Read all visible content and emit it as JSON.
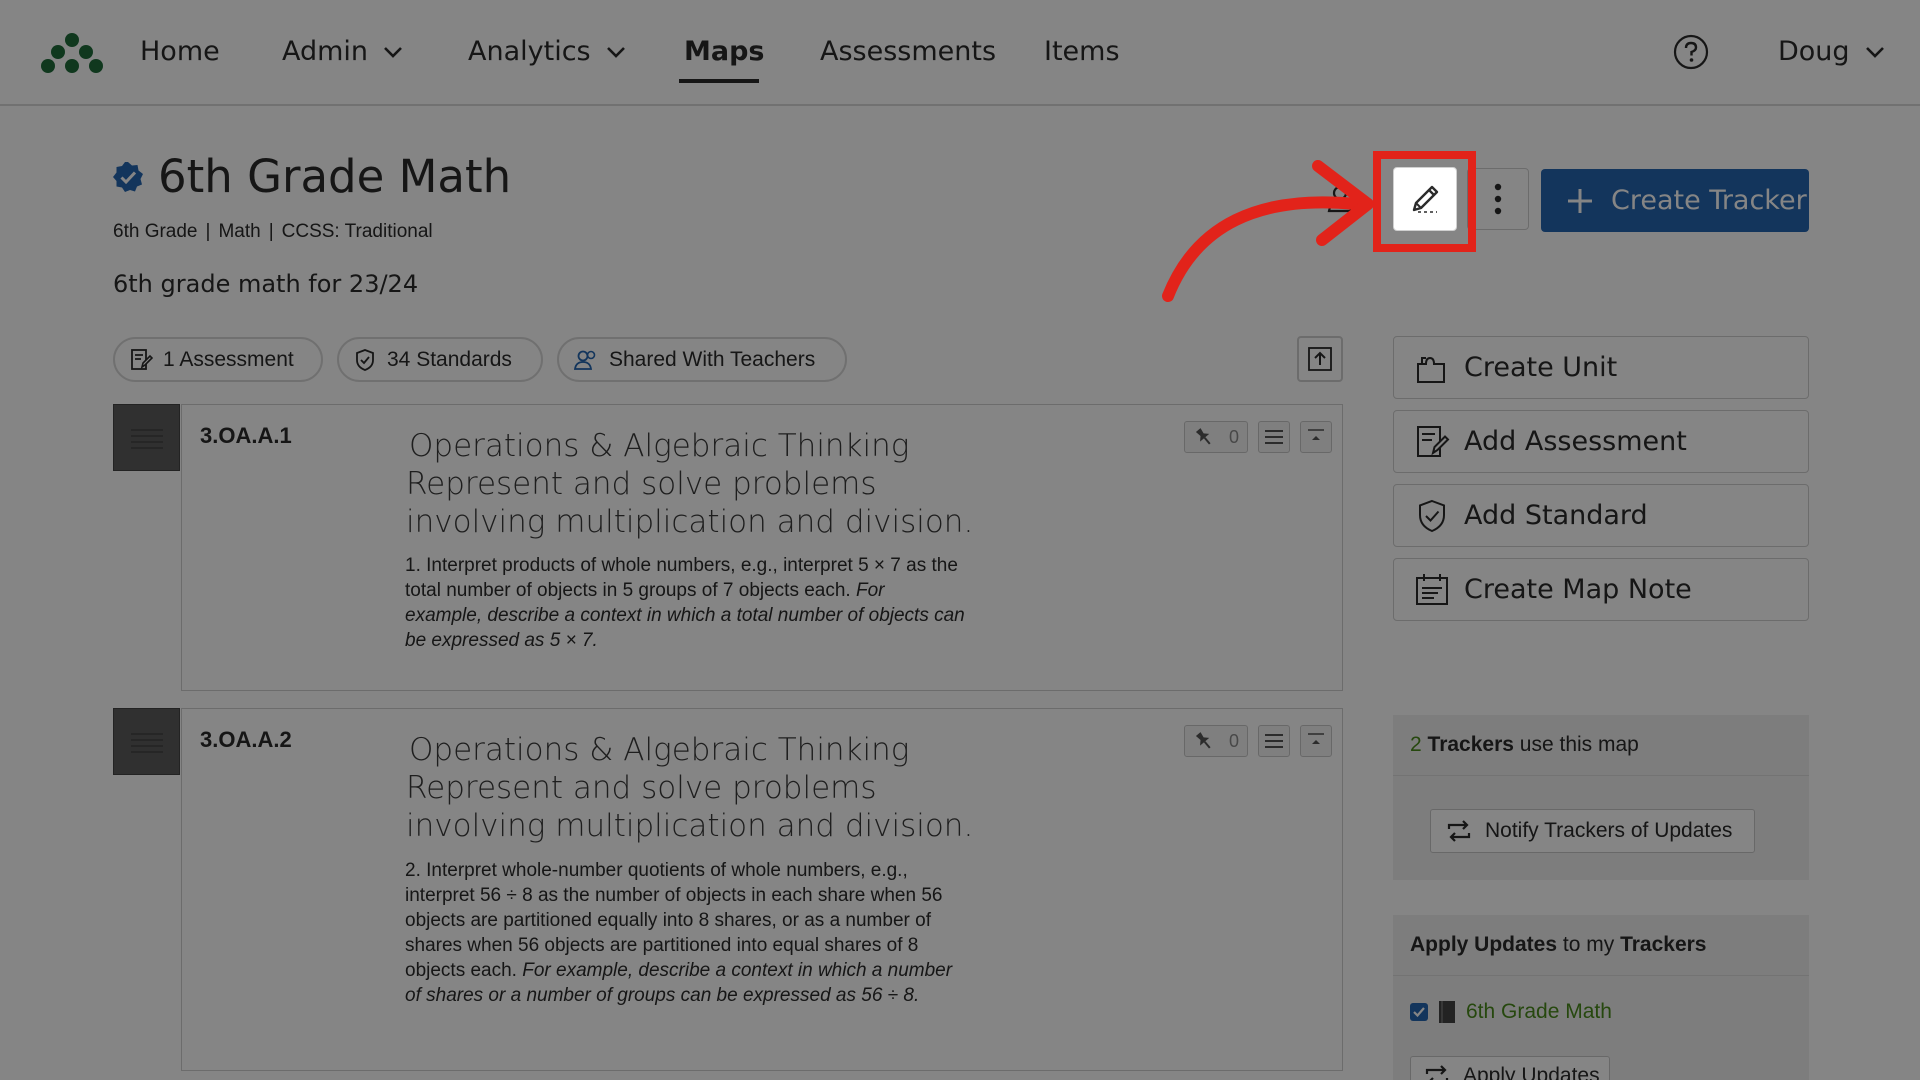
{
  "nav": {
    "home": "Home",
    "admin": "Admin",
    "analytics": "Analytics",
    "maps": "Maps",
    "assessments": "Assessments",
    "items": "Items",
    "user": "Doug"
  },
  "map": {
    "title": "6th Grade Math",
    "meta": [
      "6th Grade",
      "Math",
      "CCSS: Traditional"
    ],
    "description": "6th grade math for 23/24"
  },
  "header_actions": {
    "create_tracker": "Create Tracker"
  },
  "pills": {
    "assessments": "1 Assessment",
    "standards": "34 Standards",
    "shared": "Shared With Teachers"
  },
  "standards": [
    {
      "code": "3.OA.A.1",
      "domain": "Operations & Algebraic Thinking",
      "cluster": "Represent and solve problems involving multiplication and division.",
      "text": "1. Interpret products of whole numbers, e.g., interpret 5 × 7 as the total number of objects in 5 groups of 7 objects each.",
      "example": "For example, describe a context in which a total number of objects can be expressed as 5 × 7.",
      "pin_count": "0"
    },
    {
      "code": "3.OA.A.2",
      "domain": "Operations & Algebraic Thinking",
      "cluster": "Represent and solve problems involving multiplication and division.",
      "text": "2. Interpret whole-number quotients of whole numbers, e.g., interpret 56 ÷ 8 as the number of objects in each share when 56 objects are partitioned equally into 8 shares, or as a number of shares when 56 objects are partitioned into equal shares of 8 objects each.",
      "example": "For example, describe a context in which a number of shares or a number of groups can be expressed as 56 ÷ 8.",
      "pin_count": "0"
    }
  ],
  "actions": {
    "create_unit": "Create Unit",
    "add_assessment": "Add Assessment",
    "add_standard": "Add Standard",
    "create_map_note": "Create Map Note"
  },
  "trackers_panel": {
    "count": "2",
    "label": "Trackers",
    "suffix": "use this map",
    "notify": "Notify Trackers of Updates"
  },
  "apply_panel": {
    "prefix": "Apply Updates",
    "middle": "to my",
    "label": "Trackers",
    "tracker_name": "6th Grade Math",
    "apply_button": "Apply Updates"
  },
  "colors": {
    "primary": "#2566b0",
    "highlight": "#e2231a",
    "accent_green": "#4a8a1c",
    "logo": "#1f6b3a"
  }
}
